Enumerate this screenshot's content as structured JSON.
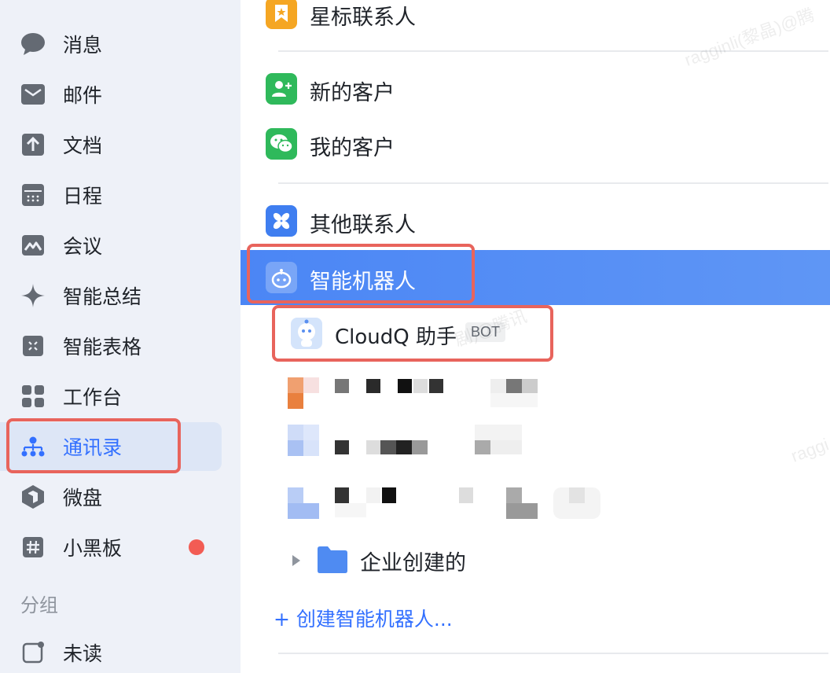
{
  "sidebar": {
    "items": [
      {
        "label": "消息",
        "icon": "message-bubble-icon"
      },
      {
        "label": "邮件",
        "icon": "mail-icon"
      },
      {
        "label": "文档",
        "icon": "doc-icon"
      },
      {
        "label": "日程",
        "icon": "calendar-icon"
      },
      {
        "label": "会议",
        "icon": "meeting-icon"
      },
      {
        "label": "智能总结",
        "icon": "sparkle-icon"
      },
      {
        "label": "智能表格",
        "icon": "smart-table-icon"
      },
      {
        "label": "工作台",
        "icon": "workbench-grid-icon"
      },
      {
        "label": "通讯录",
        "icon": "org-chart-icon",
        "active": true
      },
      {
        "label": "微盘",
        "icon": "drive-icon"
      },
      {
        "label": "小黑板",
        "icon": "hash-icon",
        "has_badge": true
      }
    ],
    "group_title": "分组",
    "group_items": [
      {
        "label": "未读",
        "icon": "unread-square-icon"
      }
    ]
  },
  "contacts": {
    "categories": [
      {
        "label": "星标联系人",
        "icon": "star-bookmark-icon",
        "color": "#f5a623"
      },
      {
        "label": "新的客户",
        "icon": "add-customer-icon",
        "color": "#2fb95b"
      },
      {
        "label": "我的客户",
        "icon": "wechat-icon",
        "color": "#2fb95b"
      },
      {
        "label": "其他联系人",
        "icon": "other-contacts-icon",
        "color": "#3f7ef0"
      },
      {
        "label": "智能机器人",
        "icon": "robot-icon",
        "color": "#ffffff",
        "selected": true
      }
    ],
    "bot": {
      "name": "CloudQ 助手",
      "tag": "BOT"
    },
    "folder": {
      "label": "企业创建的"
    },
    "create_link": "+ 创建智能机器人..."
  },
  "watermark": {
    "text1": "ragginli(黎晶)@腾",
    "text2": "raggi",
    "text3": "剧)@腾讯"
  },
  "colors": {
    "accent": "#3370ff",
    "selected_row": "#4b86f5",
    "highlight_box": "#e8645c",
    "badge": "#f25c54"
  }
}
